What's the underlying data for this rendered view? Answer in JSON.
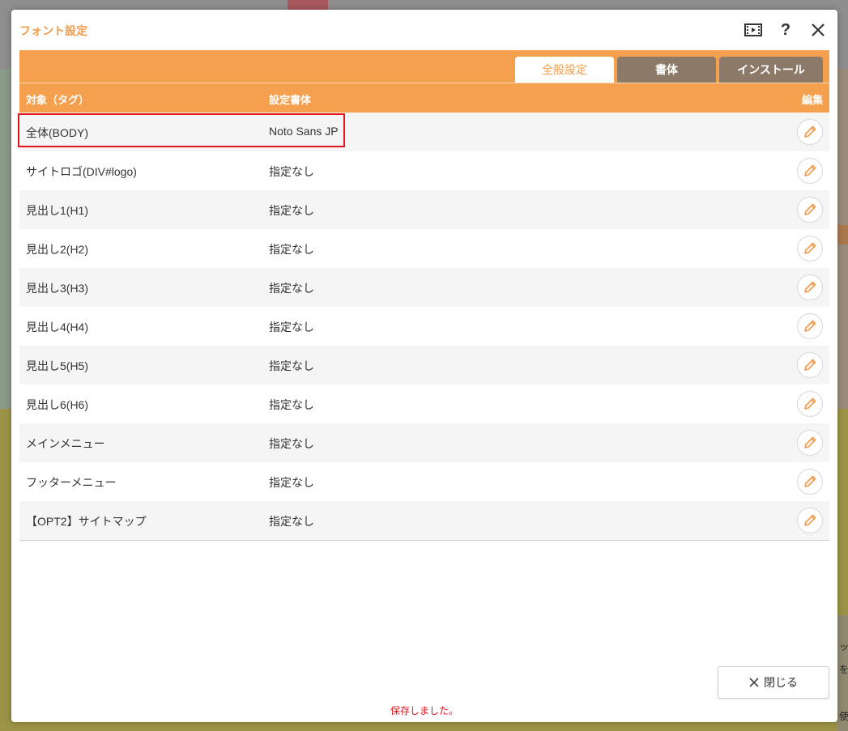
{
  "dialog": {
    "title": "フォント設定",
    "icons": [
      "film-icon",
      "help-icon",
      "close-icon"
    ],
    "help_label": "?",
    "close_label": "✕"
  },
  "tabs": [
    {
      "label": "全般設定",
      "active": true
    },
    {
      "label": "書体",
      "active": false
    },
    {
      "label": "インストール",
      "active": false
    }
  ],
  "table": {
    "headers": {
      "target": "対象（タグ）",
      "font": "設定書体",
      "edit": "編集"
    },
    "rows": [
      {
        "target": "全体(BODY)",
        "font": "Noto Sans JP"
      },
      {
        "target": "サイトロゴ(DIV#logo)",
        "font": "指定なし"
      },
      {
        "target": "見出し1(H1)",
        "font": "指定なし"
      },
      {
        "target": "見出し2(H2)",
        "font": "指定なし"
      },
      {
        "target": "見出し3(H3)",
        "font": "指定なし"
      },
      {
        "target": "見出し4(H4)",
        "font": "指定なし"
      },
      {
        "target": "見出し5(H5)",
        "font": "指定なし"
      },
      {
        "target": "見出し6(H6)",
        "font": "指定なし"
      },
      {
        "target": "メインメニュー",
        "font": "指定なし"
      },
      {
        "target": "フッターメニュー",
        "font": "指定なし"
      },
      {
        "target": "【OPT2】サイトマップ",
        "font": "指定なし"
      }
    ]
  },
  "status": {
    "saved_message": "保存しました。"
  },
  "footer": {
    "close_button_label": "閉じる"
  },
  "background_text": [
    "ッ",
    "を",
    "使"
  ],
  "colors": {
    "accent": "#f5a04e",
    "tab_inactive": "#8c7968",
    "highlight": "#e0141b"
  }
}
